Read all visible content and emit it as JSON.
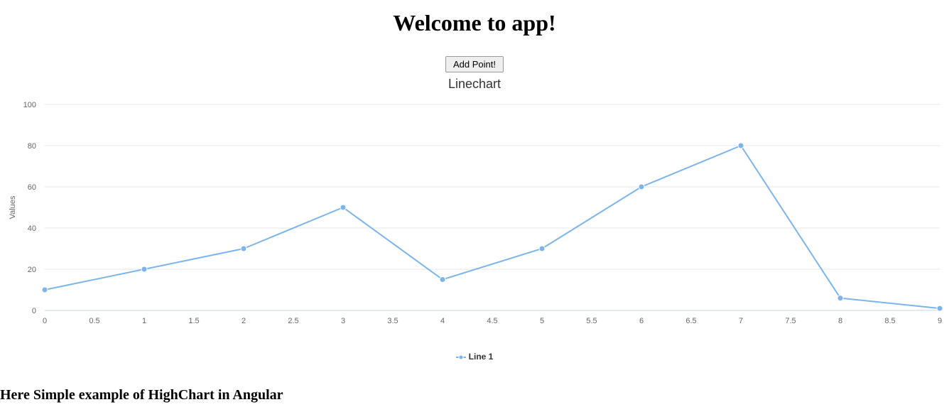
{
  "header": {
    "title": "Welcome to app!"
  },
  "controls": {
    "add_point_label": "Add Point!"
  },
  "chart_data": {
    "type": "line",
    "title": "Linechart",
    "xlabel": "",
    "ylabel": "Values",
    "xlim": [
      0,
      9
    ],
    "ylim": [
      0,
      100
    ],
    "xticks": [
      0,
      0.5,
      1,
      1.5,
      2,
      2.5,
      3,
      3.5,
      4,
      4.5,
      5,
      5.5,
      6,
      6.5,
      7,
      7.5,
      8,
      8.5,
      9
    ],
    "yticks": [
      0,
      20,
      40,
      60,
      80,
      100
    ],
    "series": [
      {
        "name": "Line 1",
        "x": [
          0,
          1,
          2,
          3,
          4,
          5,
          6,
          7,
          8,
          9
        ],
        "y": [
          10,
          20,
          30,
          50,
          15,
          30,
          60,
          80,
          6,
          1
        ]
      }
    ]
  },
  "footer": {
    "subheading": "Here Simple example of HighChart in Angular"
  }
}
